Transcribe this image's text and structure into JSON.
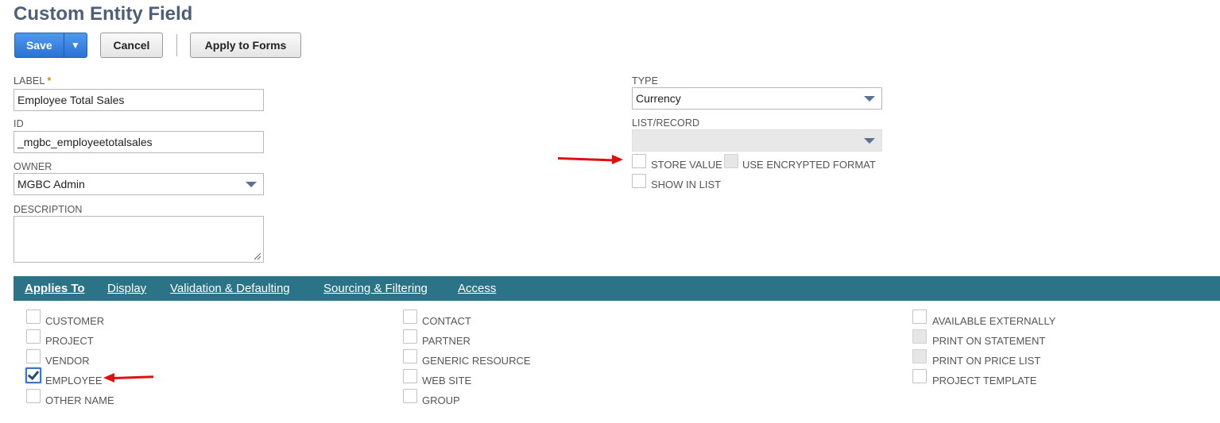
{
  "page": {
    "title": "Custom Entity Field"
  },
  "toolbar": {
    "save_label": "Save",
    "save_menu_glyph": "▼",
    "cancel_label": "Cancel",
    "apply_label": "Apply to Forms"
  },
  "form": {
    "label": {
      "label": "LABEL",
      "required_mark": "*",
      "value": "Employee Total Sales"
    },
    "id": {
      "label": "ID",
      "value": "_mgbc_employeetotalsales"
    },
    "owner": {
      "label": "OWNER",
      "value": "MGBC Admin"
    },
    "description": {
      "label": "DESCRIPTION",
      "value": ""
    },
    "type": {
      "label": "TYPE",
      "value": "Currency"
    },
    "list_record": {
      "label": "LIST/RECORD",
      "value": ""
    },
    "store_value": {
      "label": "STORE VALUE",
      "checked": false
    },
    "use_encrypted": {
      "label": "USE ENCRYPTED FORMAT",
      "checked": false,
      "disabled": true
    },
    "show_in_list": {
      "label": "SHOW IN LIST",
      "checked": false
    }
  },
  "tabs": [
    {
      "label": "Applies To",
      "active": true
    },
    {
      "label": "Display"
    },
    {
      "label": "Validation & Defaulting"
    },
    {
      "label": "Sourcing & Filtering"
    },
    {
      "label": "Access"
    }
  ],
  "applies_to": {
    "col1": [
      {
        "label": "CUSTOMER",
        "checked": false
      },
      {
        "label": "PROJECT",
        "checked": false
      },
      {
        "label": "VENDOR",
        "checked": false
      },
      {
        "label": "EMPLOYEE",
        "checked": true
      },
      {
        "label": "OTHER NAME",
        "checked": false
      }
    ],
    "col2": [
      {
        "label": "CONTACT",
        "checked": false
      },
      {
        "label": "PARTNER",
        "checked": false
      },
      {
        "label": "GENERIC RESOURCE",
        "checked": false
      },
      {
        "label": "WEB SITE",
        "checked": false
      },
      {
        "label": "GROUP",
        "checked": false
      }
    ],
    "col3": [
      {
        "label": "AVAILABLE EXTERNALLY",
        "checked": false
      },
      {
        "label": "PRINT ON STATEMENT",
        "checked": false,
        "disabled": true
      },
      {
        "label": "PRINT ON PRICE LIST",
        "checked": false,
        "disabled": true
      },
      {
        "label": "PROJECT TEMPLATE",
        "checked": false
      }
    ]
  },
  "colors": {
    "title": "#4d5f79",
    "save_button": "#2a72d4",
    "tab_bar": "#2b7386",
    "annotation_arrow": "#e01010"
  }
}
